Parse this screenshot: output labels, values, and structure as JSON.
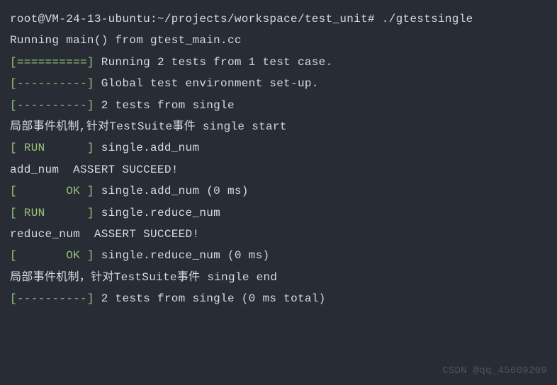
{
  "lines": [
    {
      "segments": [
        {
          "cls": "white",
          "text": "root@VM-24-13-ubuntu:~/projects/workspace/test_unit# ./gtestsingle"
        }
      ]
    },
    {
      "segments": [
        {
          "cls": "white",
          "text": "Running main() from gtest_main.cc"
        }
      ]
    },
    {
      "segments": [
        {
          "cls": "green",
          "text": "[==========] "
        },
        {
          "cls": "white",
          "text": "Running 2 tests from 1 test case."
        }
      ]
    },
    {
      "segments": [
        {
          "cls": "green",
          "text": "[----------] "
        },
        {
          "cls": "white",
          "text": "Global test environment set-up."
        }
      ]
    },
    {
      "segments": [
        {
          "cls": "green",
          "text": "[----------] "
        },
        {
          "cls": "white",
          "text": "2 tests from single"
        }
      ]
    },
    {
      "segments": [
        {
          "cls": "white",
          "text": "局部事件机制,针对TestSuite事件 single start"
        }
      ]
    },
    {
      "segments": [
        {
          "cls": "green",
          "text": "[ RUN      ] "
        },
        {
          "cls": "white",
          "text": "single.add_num"
        }
      ]
    },
    {
      "segments": [
        {
          "cls": "white",
          "text": "add_num  ASSERT SUCCEED!"
        }
      ]
    },
    {
      "segments": [
        {
          "cls": "green",
          "text": "[       OK ] "
        },
        {
          "cls": "white",
          "text": "single.add_num (0 ms)"
        }
      ]
    },
    {
      "segments": [
        {
          "cls": "green",
          "text": "[ RUN      ] "
        },
        {
          "cls": "white",
          "text": "single.reduce_num"
        }
      ]
    },
    {
      "segments": [
        {
          "cls": "white",
          "text": "reduce_num  ASSERT SUCCEED!"
        }
      ]
    },
    {
      "segments": [
        {
          "cls": "green",
          "text": "[       OK ] "
        },
        {
          "cls": "white",
          "text": "single.reduce_num (0 ms)"
        }
      ]
    },
    {
      "segments": [
        {
          "cls": "white",
          "text": "局部事件机制，针对TestSuite事件 single end"
        }
      ]
    },
    {
      "segments": [
        {
          "cls": "green",
          "text": "[----------] "
        },
        {
          "cls": "white",
          "text": "2 tests from single (0 ms total)"
        }
      ]
    }
  ],
  "watermark": "CSDN @qq_45609209"
}
